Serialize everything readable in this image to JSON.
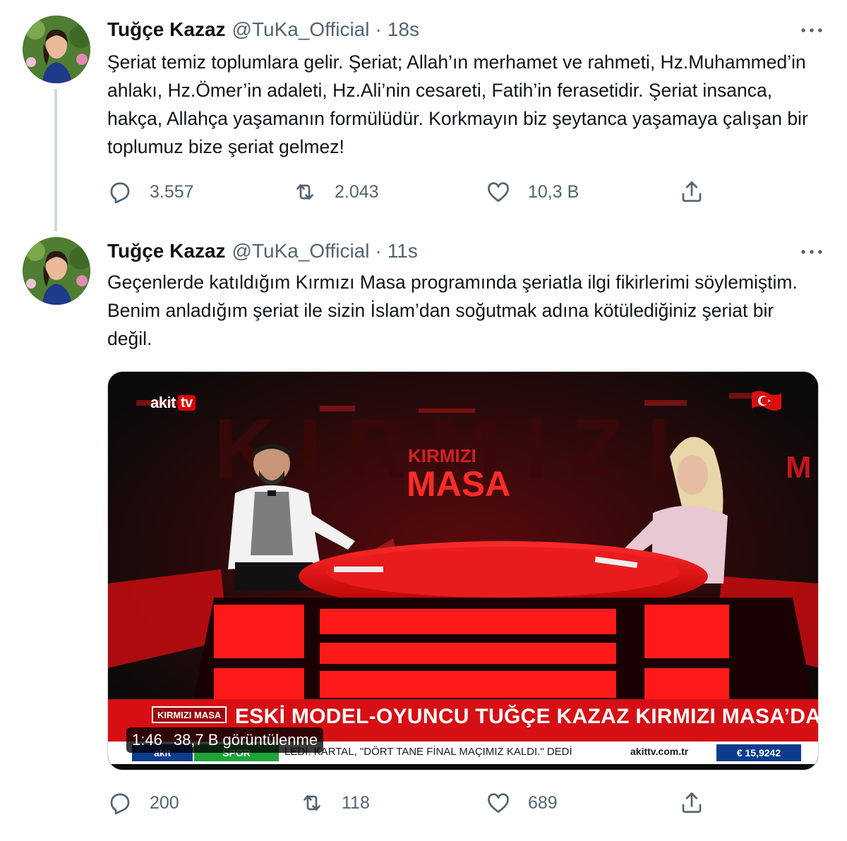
{
  "tweets": [
    {
      "author": {
        "name": "Tuğçe Kazaz",
        "handle": "@TuKa_Official"
      },
      "separator": "·",
      "time": "18s",
      "text": "Şeriat temiz toplumlara gelir. Şeriat; Allah’ın merhamet ve rahmeti, Hz.Muhammed’in ahlakı, Hz.Ömer’in adaleti, Hz.Ali’nin cesareti, Fatih’in ferasetidir. Şeriat insanca, hakça, Allahça yaşamanın formülüdür. Korkmayın biz şeytanca yaşamaya çalışan bir toplumuz bize şeriat gelmez!",
      "stats": {
        "replies": "3.557",
        "retweets": "2.043",
        "likes": "10,3 B"
      }
    },
    {
      "author": {
        "name": "Tuğçe Kazaz",
        "handle": "@TuKa_Official"
      },
      "separator": "·",
      "time": "11s",
      "text": "Geçenlerde katıldığım Kırmızı Masa programında şeriatla ilgi fikirlerimi söylemiştim. Benim anladığım şeriat ile sizin İslam’dan soğutmak adına kötülediğiniz şeriat bir değil.",
      "stats": {
        "replies": "200",
        "retweets": "118",
        "likes": "689"
      },
      "video": {
        "duration": "1:46",
        "views": "38,7 B görüntülenme",
        "channel_logo": "akit",
        "channel_logo_tv": "tv",
        "set_sign_line1": "KIRMIZI",
        "set_sign_line2": "MASA",
        "lower_third_tag": "KIRMIZI MASA",
        "headline": "ESKİ MODEL-OYUNCU TUĞÇE KAZAZ KIRMIZI MASA’DA",
        "ticker_logo": "akit",
        "ticker_section": "SPOR",
        "ticker_text": "LEDİ. KARTAL, \"DÖRT TANE FİNAL MAÇIMIZ KALDI.\" DEDİ",
        "ticker_site": "akittv.com.tr",
        "ticker_rate": "€ 15,9242"
      }
    }
  ],
  "icons": {
    "reply": "reply-icon",
    "retweet": "retweet-icon",
    "like": "heart-icon",
    "share": "share-icon",
    "more": "more-icon"
  },
  "colors": {
    "text": "#0f1419",
    "secondary": "#536471",
    "thread_line": "#cfd9de",
    "studio_red": "#d60f14"
  }
}
